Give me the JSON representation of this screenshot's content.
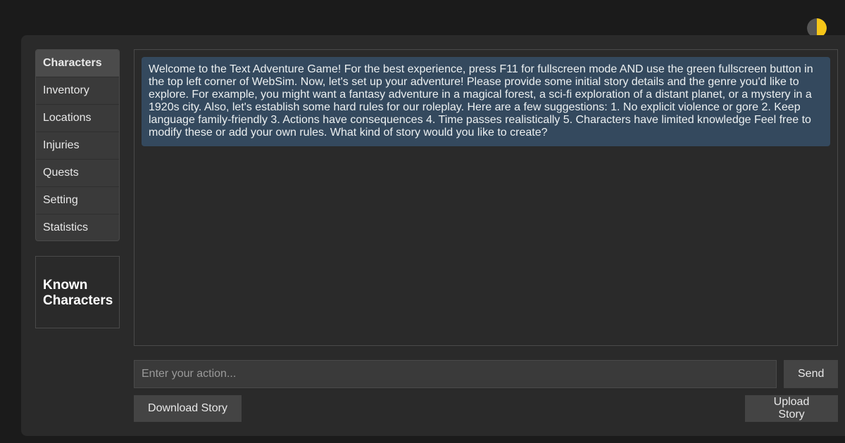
{
  "tabs": [
    {
      "label": "Characters",
      "active": true
    },
    {
      "label": "Inventory",
      "active": false
    },
    {
      "label": "Locations",
      "active": false
    },
    {
      "label": "Injuries",
      "active": false
    },
    {
      "label": "Quests",
      "active": false
    },
    {
      "label": "Setting",
      "active": false
    },
    {
      "label": "Statistics",
      "active": false
    }
  ],
  "known_panel": {
    "title": "Known Characters"
  },
  "story": {
    "messages": [
      {
        "text": "Welcome to the Text Adventure Game! For the best experience, press F11 for fullscreen mode AND use the green fullscreen button in the top left corner of WebSim. Now, let's set up your adventure! Please provide some initial story details and the genre you'd like to explore. For example, you might want a fantasy adventure in a magical forest, a sci-fi exploration of a distant planet, or a mystery in a 1920s city. Also, let's establish some hard rules for our roleplay. Here are a few suggestions: 1. No explicit violence or gore 2. Keep language family-friendly 3. Actions have consequences 4. Time passes realistically 5. Characters have limited knowledge Feel free to modify these or add your own rules. What kind of story would you like to create?"
      }
    ]
  },
  "input": {
    "value": "",
    "placeholder": "Enter your action..."
  },
  "buttons": {
    "send": "Send",
    "download": "Download Story",
    "upload": "Upload Story"
  },
  "icons": {
    "theme_toggle": "half-moon-theme-icon"
  },
  "colors": {
    "background": "#1b1b1b",
    "panel": "#2a2a2a",
    "message_bg": "#34495e",
    "button_bg": "#444444",
    "toggle_light": "#f5c518",
    "toggle_dark": "#555555"
  }
}
